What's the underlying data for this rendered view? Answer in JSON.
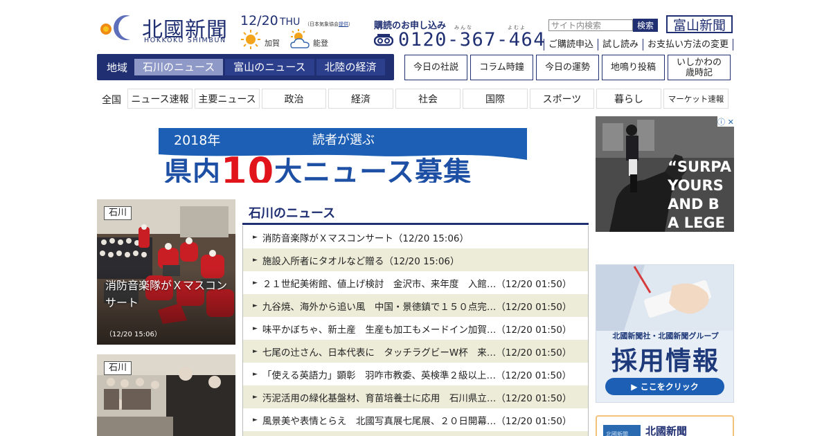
{
  "header": {
    "logo_kanji": "北國新聞",
    "logo_roman": "HOKKOKU SHIMBUN",
    "date": "12/20",
    "day_of_week": "THU",
    "jma_prefix": "（日本気象協会",
    "jma_link": "提供",
    "jma_suffix": "）",
    "weather": [
      {
        "region": "加賀",
        "icon": "sun-icon"
      },
      {
        "region": "能登",
        "icon": "sun-cloud-icon"
      }
    ],
    "subscribe_title": "購読のお申し込み",
    "subscribe_ruby_1": "みんな",
    "subscribe_ruby_2": "よむよ",
    "phone": "0120-367-464",
    "search": {
      "placeholder": "サイト内検索",
      "button": "検索"
    },
    "toyama_logo": "富山新聞",
    "util_links": [
      "ご購読申込",
      "試し読み",
      "お支払い方法の変更"
    ]
  },
  "region_nav": {
    "label": "地域",
    "tabs": [
      "石川のニュース",
      "富山のニュース",
      "北陸の経済"
    ],
    "active_index": 0
  },
  "feature_buttons": [
    "今日の社説",
    "コラム時鐘",
    "今日の運勢",
    "地鳴り投稿",
    "いしかわの",
    "歳時記"
  ],
  "categories": {
    "first": "全国",
    "items": [
      "ニュース速報",
      "主要ニュース",
      "政治",
      "経済",
      "社会",
      "国際",
      "スポーツ",
      "暮らし",
      "マーケット速報"
    ]
  },
  "banner": {
    "year": "2018年",
    "reader": "読者が選ぶ",
    "main_before": "県内",
    "main_num": "10",
    "main_after": "大ニュース募集"
  },
  "photo_cards": [
    {
      "tag": "石川",
      "caption_1": "消防音楽隊がＸマスコン",
      "caption_2": "サート",
      "time": "（12/20 15:06）"
    },
    {
      "tag": "石川",
      "caption_1": "",
      "caption_2": "",
      "time": ""
    }
  ],
  "news_section": {
    "title": "石川のニュース",
    "items": [
      {
        "title": "消防音楽隊がＸマスコンサート",
        "time": "（12/20 15:06）"
      },
      {
        "title": "施設入所者にタオルなど贈る",
        "time": "（12/20 15:06）"
      },
      {
        "title": "２１世紀美術館、値上げ検討　金沢市、来年度　入館…",
        "time": "（12/20 01:50）"
      },
      {
        "title": "九谷焼、海外から追い風　中国・景徳鎮で１５０点完…",
        "time": "（12/20 01:50）"
      },
      {
        "title": "味平かぼちゃ、新土産　生産も加工もメードイン加賀…",
        "time": "（12/20 01:50）"
      },
      {
        "title": "七尾の辻さん、日本代表に　タッチラグビーW杯　来…",
        "time": "（12/20 01:50）"
      },
      {
        "title": "「使える英語力」顕彰　羽咋市教委、英検準２級以上…",
        "time": "（12/20 01:50）"
      },
      {
        "title": "汚泥活用の緑化基盤材、育苗培養士に応用　石川県立…",
        "time": "（12/20 01:50）"
      },
      {
        "title": "風景美や表情とらえ　北國写真展七尾展、２０日開幕…",
        "time": "（12/20 01:50）"
      }
    ]
  },
  "ads": {
    "horse_text": "“SURPA\nYOURS\nAND B\nA LEGE",
    "adchoice": "ⓘ ✕",
    "recruit_sub": "北國新聞社・北國新聞グループ",
    "recruit_main": "採用情報",
    "recruit_btn": "▶ ここをクリック",
    "bottom_text": "北國新聞",
    "bottom_small": "北國新聞"
  },
  "colors": {
    "navy": "#1f2f72",
    "active_tab": "#8e99c8",
    "row_alt": "#ececd9",
    "banner_blue": "#1c5fb4",
    "banner_red": "#e1141c"
  }
}
